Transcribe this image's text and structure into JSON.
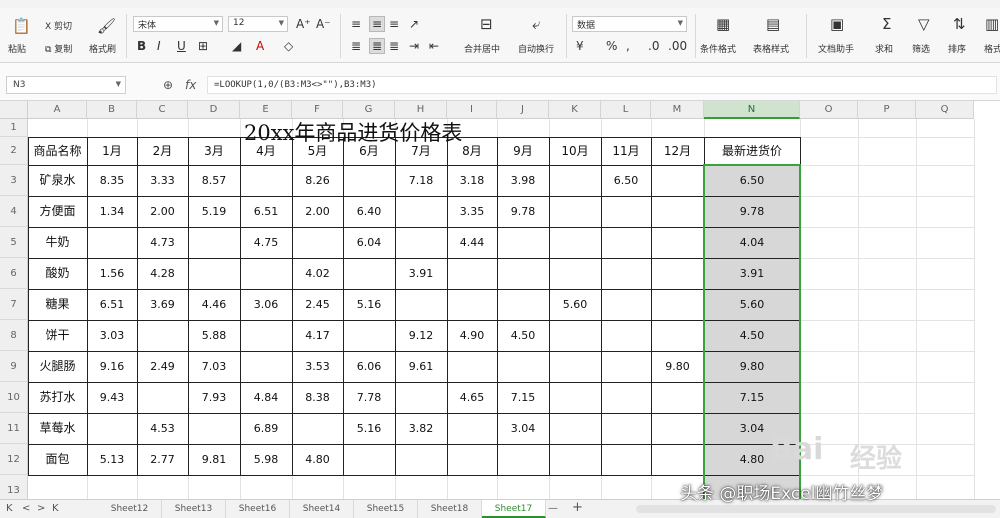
{
  "ribbon": {
    "clipboard": {
      "cut": "X 剪切",
      "paste": "粘贴",
      "copy": "复制",
      "format_painter": "格式刷"
    },
    "font": {
      "name": "宋体",
      "size": "12",
      "bold": "B",
      "italic": "I",
      "underline": "U"
    },
    "align": {
      "merge": "合并居中",
      "wrap": "自动换行"
    },
    "number": {
      "format": "数据",
      "percent": "%"
    },
    "styles": {
      "conditional": "条件格式",
      "table_style": "表格样式"
    },
    "tools": {
      "doc_helper": "文档助手",
      "sum": "求和",
      "filter": "筛选",
      "sort": "排序",
      "format": "格式"
    }
  },
  "formula_bar": {
    "name_box": "N3",
    "fx": "fx",
    "formula": "=LOOKUP(1,0/(B3:M3<>\"\"),B3:M3)"
  },
  "columns": [
    "A",
    "B",
    "C",
    "D",
    "E",
    "F",
    "G",
    "H",
    "I",
    "J",
    "K",
    "L",
    "M",
    "N",
    "O",
    "P",
    "Q"
  ],
  "row_numbers": [
    "1",
    "2",
    "3",
    "4",
    "5",
    "6",
    "7",
    "8",
    "9",
    "10",
    "11",
    "12",
    "13"
  ],
  "sheet": {
    "title": "20xx年商品进货价格表",
    "headers": [
      "商品名称",
      "1月",
      "2月",
      "3月",
      "4月",
      "5月",
      "6月",
      "7月",
      "8月",
      "9月",
      "10月",
      "11月",
      "12月",
      "最新进货价"
    ],
    "rows": [
      [
        "矿泉水",
        "8.35",
        "3.33",
        "8.57",
        "",
        "8.26",
        "",
        "7.18",
        "3.18",
        "3.98",
        "",
        "6.50",
        "",
        "6.50"
      ],
      [
        "方便面",
        "1.34",
        "2.00",
        "5.19",
        "6.51",
        "2.00",
        "6.40",
        "",
        "3.35",
        "9.78",
        "",
        "",
        "",
        "9.78"
      ],
      [
        "牛奶",
        "",
        "4.73",
        "",
        "4.75",
        "",
        "6.04",
        "",
        "4.44",
        "",
        "",
        "",
        "",
        "4.04"
      ],
      [
        "酸奶",
        "1.56",
        "4.28",
        "",
        "",
        "4.02",
        "",
        "3.91",
        "",
        "",
        "",
        "",
        "",
        "3.91"
      ],
      [
        "糖果",
        "6.51",
        "3.69",
        "4.46",
        "3.06",
        "2.45",
        "5.16",
        "",
        "",
        "",
        "5.60",
        "",
        "",
        "5.60"
      ],
      [
        "饼干",
        "3.03",
        "",
        "5.88",
        "",
        "4.17",
        "",
        "9.12",
        "4.90",
        "4.50",
        "",
        "",
        "",
        "4.50"
      ],
      [
        "火腿肠",
        "9.16",
        "2.49",
        "7.03",
        "",
        "3.53",
        "6.06",
        "9.61",
        "",
        "",
        "",
        "",
        "9.80",
        "9.80"
      ],
      [
        "苏打水",
        "9.43",
        "",
        "7.93",
        "4.84",
        "8.38",
        "7.78",
        "",
        "4.65",
        "7.15",
        "",
        "",
        "",
        "7.15"
      ],
      [
        "草莓水",
        "",
        "4.53",
        "",
        "6.89",
        "",
        "5.16",
        "3.82",
        "",
        "3.04",
        "",
        "",
        "",
        "3.04"
      ],
      [
        "面包",
        "5.13",
        "2.77",
        "9.81",
        "5.98",
        "4.80",
        "",
        "",
        "",
        "",
        "",
        "",
        "",
        "4.80"
      ]
    ]
  },
  "sheet_tabs": [
    "Sheet12",
    "Sheet13",
    "Sheet16",
    "Sheet14",
    "Sheet15",
    "Sheet18",
    "Sheet17"
  ],
  "active_sheet": "Sheet17",
  "nav": {
    "first": "K",
    "prev": "<",
    "next": ">",
    "last": "K",
    "add": "+",
    "more": "—"
  },
  "watermark": {
    "logo": "Bai",
    "suffix": "经验"
  },
  "credit": "头条 @职场Excel幽竹丝梦",
  "colors": {
    "accent": "#3aa23a",
    "selected_fill": "#d7d7d7"
  }
}
